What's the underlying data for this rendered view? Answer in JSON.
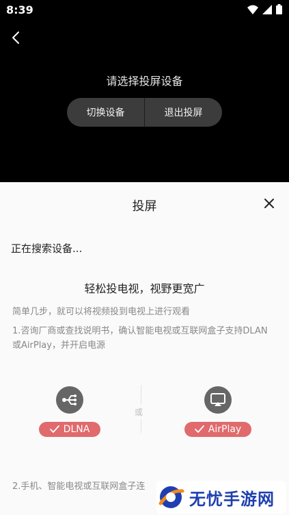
{
  "status_bar": {
    "time": "8:39"
  },
  "header": {
    "prompt": "请选择投屏设备"
  },
  "controls": {
    "switch_label": "切换设备",
    "exit_label": "退出投屏"
  },
  "sheet": {
    "title": "投屏",
    "searching": "正在搜索设备...",
    "heading": "轻松投电视，视野更宽广",
    "subtitle": "简单几步，就可以将视频投到电视上进行观看",
    "step1": "1.咨询厂商或查找说明书，确认智能电视或互联网盒子支持DLAN或AirPlay，并开启电源",
    "or_label": "或",
    "devices": [
      {
        "label": "DLNA",
        "icon": "share-icon"
      },
      {
        "label": "AirPlay",
        "icon": "airplay-icon"
      }
    ],
    "step2": "2.手机、智能电视或互联网盒子连"
  },
  "watermark": {
    "text": "无忧手游网"
  },
  "colors": {
    "accent": "#e06a6c",
    "icon_bg": "#666666"
  }
}
